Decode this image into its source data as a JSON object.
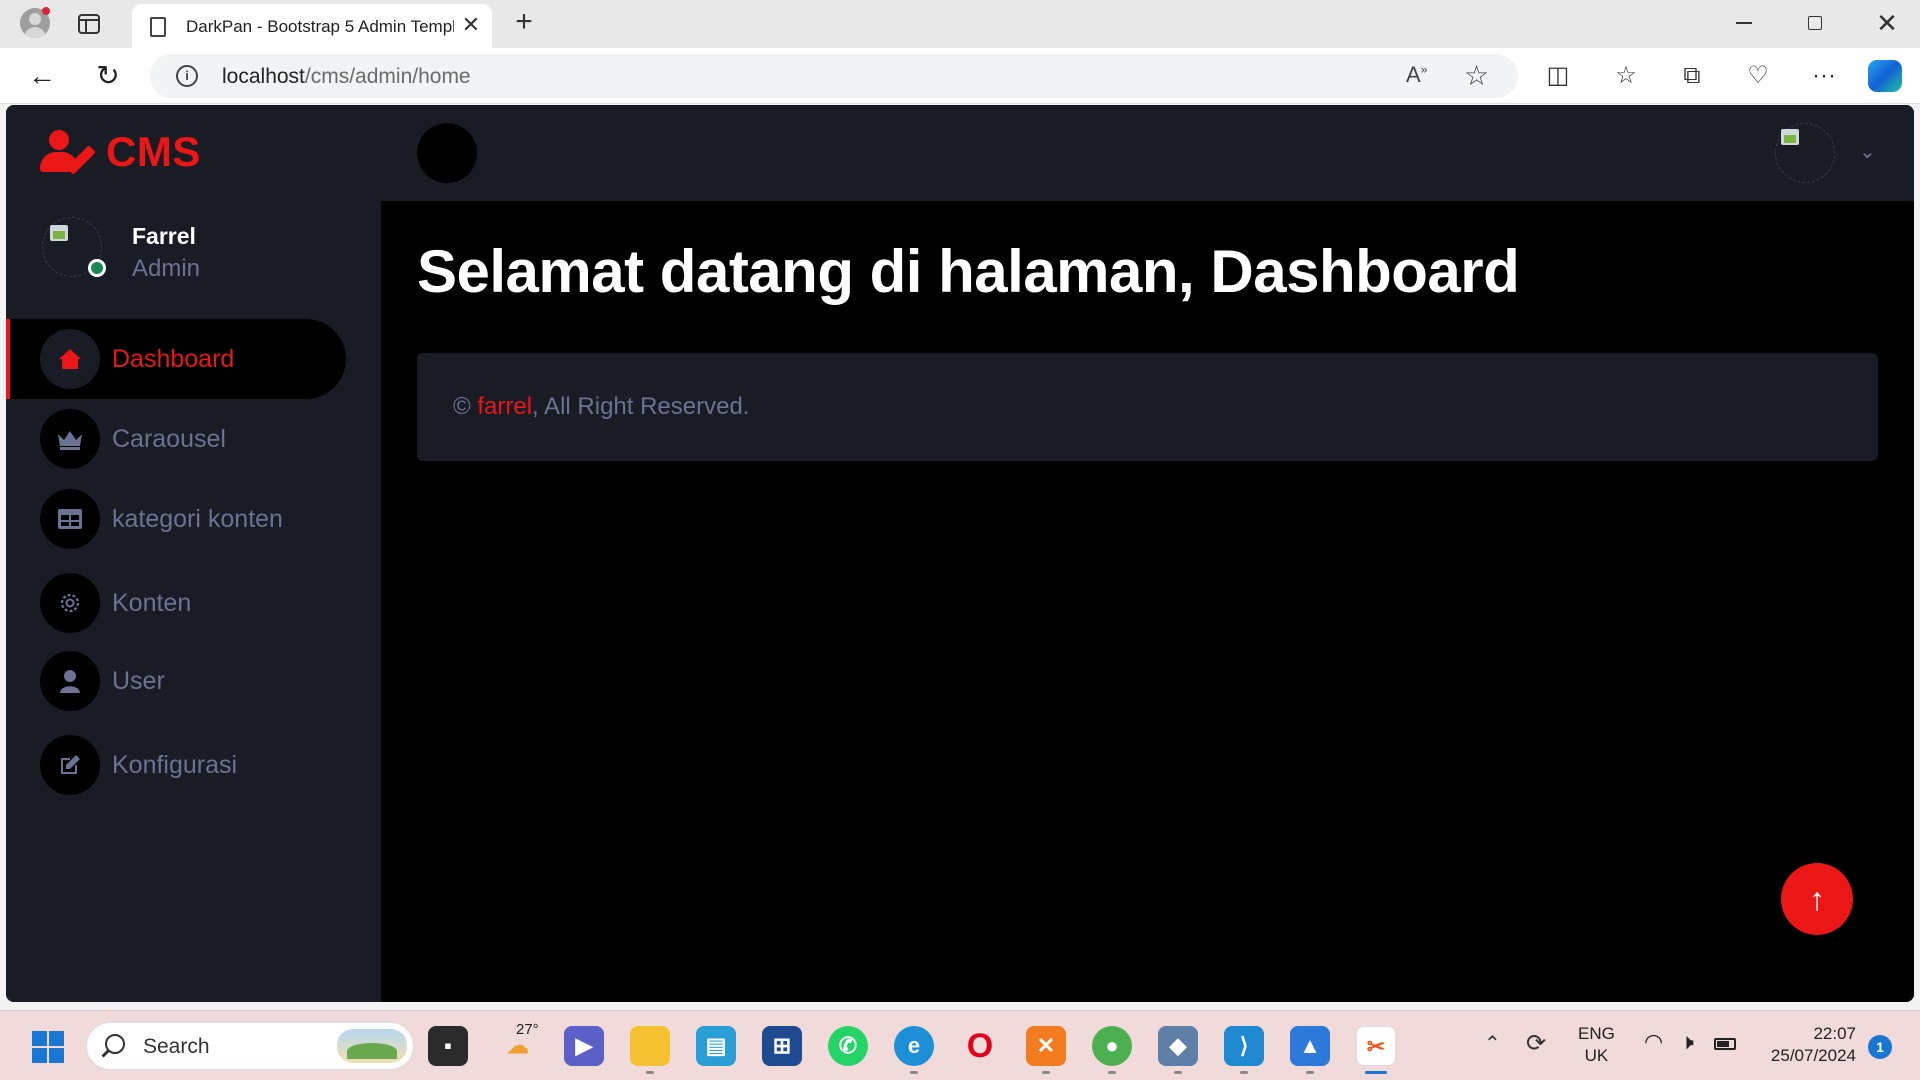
{
  "browser": {
    "tab_title": "DarkPan - Bootstrap 5 Admin Template",
    "tab_close": "✕",
    "new_tab": "+",
    "url_host": "localhost",
    "url_path": "/cms/admin/home",
    "window_controls": [
      "minimize",
      "restore",
      "close"
    ]
  },
  "page": {
    "brand": "CMS",
    "profile": {
      "name": "Farrel",
      "role": "Admin"
    },
    "menu": [
      {
        "label": "Dashboard",
        "icon": "home-icon",
        "active": true
      },
      {
        "label": "Caraousel",
        "icon": "crown-icon",
        "active": false
      },
      {
        "label": "kategori konten",
        "icon": "table-icon",
        "active": false
      },
      {
        "label": "Konten",
        "icon": "gear-icon",
        "active": false
      },
      {
        "label": "User",
        "icon": "user-icon",
        "active": false
      },
      {
        "label": "Konfigurasi",
        "icon": "edit-icon",
        "active": false
      }
    ],
    "heading": "Selamat datang di halaman, Dashboard",
    "footer": {
      "prefix": "© ",
      "link": "farrel",
      "suffix": ", All Right Reserved."
    },
    "accent_color": "#eb1616"
  },
  "taskbar": {
    "search_placeholder": "Search",
    "weather_temp": "27°",
    "lang_line1": "ENG",
    "lang_line2": "UK",
    "time": "22:07",
    "date": "25/07/2024",
    "notifications": "1"
  }
}
